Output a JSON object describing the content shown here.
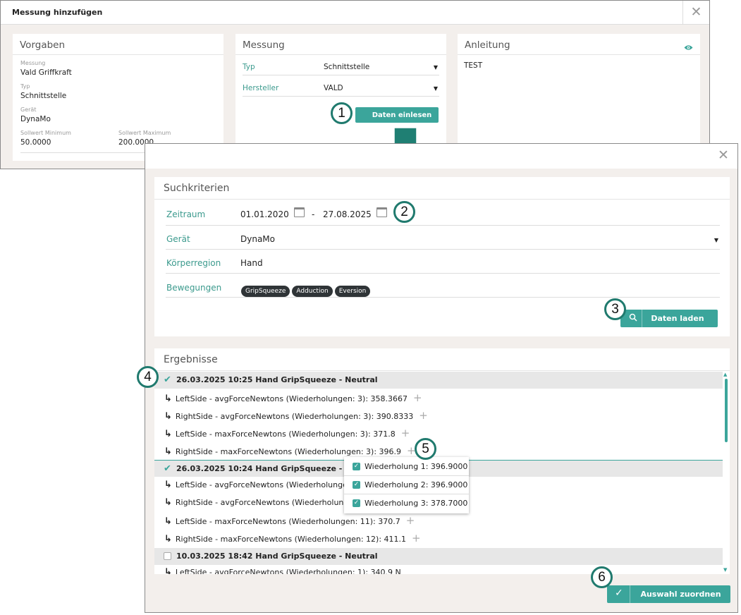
{
  "dialog_top": {
    "title": "Messung hinzufügen",
    "close": "✕",
    "vorgaben": {
      "title": "Vorgaben",
      "messung_label": "Messung",
      "messung_value": "Vald Griffkraft",
      "typ_label": "Typ",
      "typ_value": "Schnittstelle",
      "geraet_label": "Gerät",
      "geraet_value": "DynaMo",
      "min_label": "Sollwert Minimum",
      "min_value": "50.0000",
      "max_label": "Sollwert Maximum",
      "max_value": "200.0000"
    },
    "messung": {
      "title": "Messung",
      "typ_label": "Typ",
      "typ_value": "Schnittstelle",
      "hersteller_label": "Hersteller",
      "hersteller_value": "VALD",
      "button": "Daten einlesen"
    },
    "anleitung": {
      "title": "Anleitung",
      "text": "TEST"
    }
  },
  "dialog_bottom": {
    "close": "✕",
    "suchkriterien": {
      "title": "Suchkriterien",
      "zeitraum_label": "Zeitraum",
      "date_from": "01.01.2020",
      "date_sep": "-",
      "date_to": "27.08.2025",
      "geraet_label": "Gerät",
      "geraet_value": "DynaMo",
      "koerper_label": "Körperregion",
      "koerper_value": "Hand",
      "bewegungen_label": "Bewegungen",
      "bewegungen": [
        "GripSqueeze",
        "Adduction",
        "Eversion"
      ],
      "button": "Daten laden"
    },
    "ergebnisse": {
      "title": "Ergebnisse",
      "groups": [
        {
          "label": "26.03.2025 10:25 Hand GripSqueeze - Neutral",
          "checked": true,
          "rows": [
            "LeftSide - avgForceNewtons (Wiederholungen: 3): 358.3667",
            "RightSide - avgForceNewtons (Wiederholungen: 3): 390.8333",
            "LeftSide - maxForceNewtons (Wiederholungen: 3): 371.8",
            "RightSide - maxForceNewtons (Wiederholungen: 3): 396.9"
          ]
        },
        {
          "label": "26.03.2025 10:24 Hand GripSqueeze - Neutral",
          "checked": true,
          "rows": [
            "LeftSide - avgForceNewtons (Wiederholungen",
            "RightSide - avgForceNewtons (Wiederholung",
            "LeftSide - maxForceNewtons (Wiederholungen: 11): 370.7",
            "RightSide - maxForceNewtons (Wiederholungen: 12): 411.1"
          ]
        },
        {
          "label": "10.03.2025 18:42 Hand GripSqueeze - Neutral",
          "checked": false,
          "rows": [
            "LeftSide - avgForceNewtons (Wiederholungen: 1): 340.9 N"
          ]
        }
      ],
      "popup": [
        "Wiederholung 1: 396.9000",
        "Wiederholung 2: 396.9000",
        "Wiederholung 3: 378.7000"
      ]
    },
    "assign_button": "Auswahl zuordnen"
  },
  "callouts": [
    "1",
    "2",
    "3",
    "4",
    "5",
    "6"
  ],
  "colors": {
    "accent": "#3ba59b",
    "label": "#3b9a8d",
    "callout_border": "#207a6e",
    "arrow": "#1f7f73"
  }
}
